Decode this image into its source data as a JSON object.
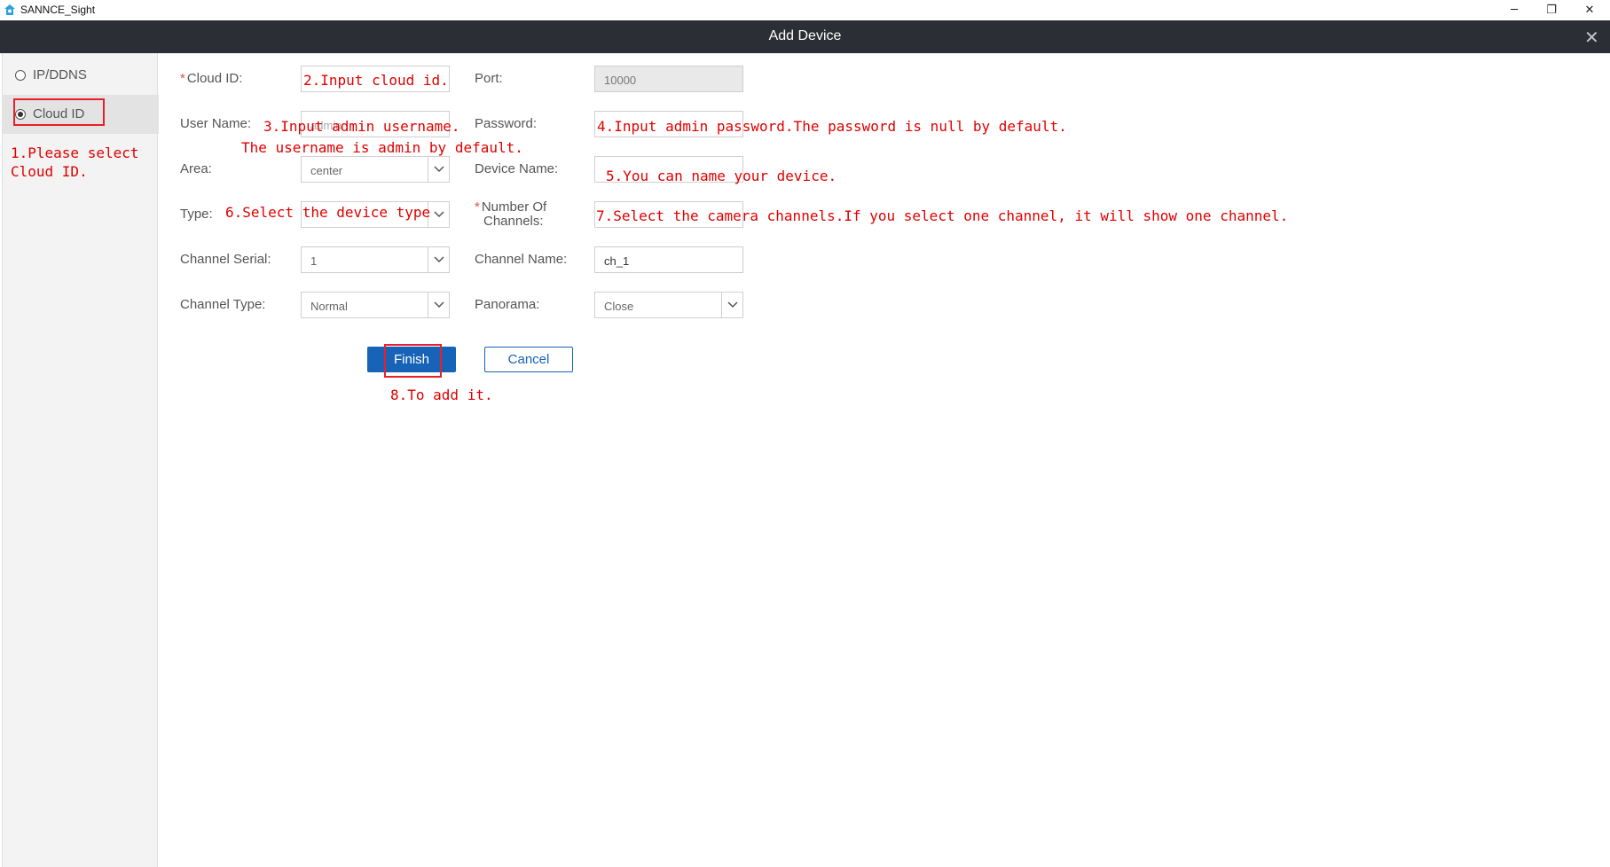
{
  "app": {
    "title": "SANNCE_Sight"
  },
  "window_controls": {
    "minimize": "─",
    "restore": "❐",
    "close": "✕"
  },
  "dialog": {
    "title": "Add Device",
    "close": "✕"
  },
  "sidebar": {
    "items": [
      {
        "label": "IP/DDNS",
        "checked": false
      },
      {
        "label": "Cloud ID",
        "checked": true
      }
    ]
  },
  "form": {
    "cloud_id": {
      "label": "Cloud ID:",
      "value": ""
    },
    "port": {
      "label": "Port:",
      "value": "10000"
    },
    "user_name": {
      "label": "User Name:",
      "value": "admin"
    },
    "password": {
      "label": "Password:",
      "value": ""
    },
    "area": {
      "label": "Area:",
      "value": "center"
    },
    "device_name": {
      "label": "Device Name:",
      "value": ""
    },
    "type": {
      "label": "Type:",
      "value": ""
    },
    "number_of_channels": {
      "label_line1": "Number Of",
      "label_line2": "Channels:",
      "value": ""
    },
    "channel_serial": {
      "label": "Channel Serial:",
      "value": "1"
    },
    "channel_name": {
      "label": "Channel Name:",
      "value": "ch_1"
    },
    "channel_type": {
      "label": "Channel Type:",
      "value": "Normal"
    },
    "panorama": {
      "label": "Panorama:",
      "value": "Close"
    }
  },
  "buttons": {
    "finish": "Finish",
    "cancel": "Cancel"
  },
  "annotations": {
    "a1_line1": "1.Please select",
    "a1_line2": "Cloud ID.",
    "a2": "2.Input cloud id.",
    "a3_line1": "3.Input admin username.",
    "a3_line2": "The username is admin by default.",
    "a4": "4.Input admin password.The password is null by default.",
    "a5": "5.You can name your device.",
    "a6": "6.Select the device type",
    "a7": "7.Select the camera channels.If you select one channel, it will show one channel.",
    "a8": "8.To add it."
  },
  "colors": {
    "accent": "#1663b7",
    "annotation": "#e00000",
    "header": "#2b2e34"
  }
}
